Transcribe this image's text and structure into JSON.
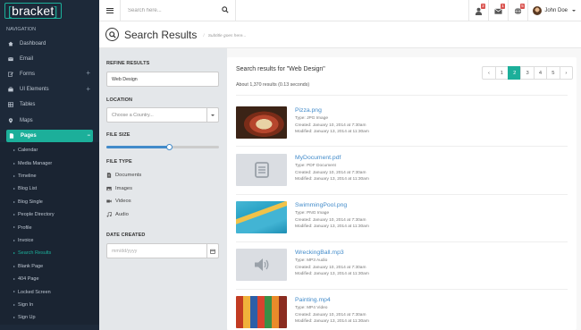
{
  "app": {
    "logo": "bracket",
    "logo_bracket_open": "[",
    "logo_bracket_close": "]"
  },
  "header": {
    "search_placeholder": "Search here...",
    "notifications": [
      {
        "icon": "user-icon",
        "count": "2"
      },
      {
        "icon": "envelope-icon",
        "count": "1"
      },
      {
        "icon": "globe-icon",
        "count": "5"
      }
    ],
    "user_name": "John Doe"
  },
  "sidebar": {
    "title": "NAVIGATION",
    "items": [
      {
        "label": "Dashboard",
        "icon": "home-icon"
      },
      {
        "label": "Email",
        "icon": "envelope-icon"
      },
      {
        "label": "Forms",
        "icon": "edit-icon",
        "expandable": "+"
      },
      {
        "label": "UI Elements",
        "icon": "suitcase-icon",
        "expandable": "+"
      },
      {
        "label": "Tables",
        "icon": "table-icon"
      },
      {
        "label": "Maps",
        "icon": "map-marker-icon"
      },
      {
        "label": "Pages",
        "icon": "file-icon",
        "expandable": "−"
      }
    ],
    "sub_items": [
      "Calendar",
      "Media Manager",
      "Timeline",
      "Blog List",
      "Blog Single",
      "People Directory",
      "Profile",
      "Invoice",
      "Search Results",
      "Blank Page",
      "404 Page",
      "Locked Screen",
      "Sign In",
      "Sign Up"
    ],
    "current_sub": "Search Results"
  },
  "page": {
    "title": "Search Results",
    "subtitle": "Subtitle goes here..."
  },
  "refine": {
    "title": "REFINE RESULTS",
    "query": "Web Design",
    "location_label": "LOCATION",
    "location_placeholder": "Choose a Country...",
    "filesize_label": "FILE SIZE",
    "filesize_fraction": 0.56,
    "filetype_label": "FILE TYPE",
    "filetypes": [
      {
        "label": "Documents",
        "icon": "file-text-icon"
      },
      {
        "label": "Images",
        "icon": "image-icon"
      },
      {
        "label": "Videos",
        "icon": "video-icon"
      },
      {
        "label": "Audio",
        "icon": "music-icon"
      }
    ],
    "date_label": "DATE CREATED",
    "date_placeholder": "mm/dd/yyyy"
  },
  "results": {
    "heading": "Search results for \"Web Design\"",
    "summary": "About 1,370 results (0.13 seconds)",
    "pagination": {
      "prev": "‹",
      "pages": [
        "1",
        "2",
        "3",
        "4",
        "5"
      ],
      "active": "2",
      "next": "›"
    },
    "items": [
      {
        "name": "Pizza.png",
        "type": "Type: JPG Image",
        "created": "Created: January 10, 2014 at 7:30am",
        "modified": "Modified: January 13, 2014 at 11:30am",
        "thumb": "pizza"
      },
      {
        "name": "MyDocument.pdf",
        "type": "Type: PDF Document",
        "created": "Created: January 10, 2014 at 7:30am",
        "modified": "Modified: January 13, 2014 at 11:30am",
        "thumb": "document"
      },
      {
        "name": "SwimmingPool.png",
        "type": "Type: PNG Image",
        "created": "Created: January 10, 2014 at 7:30am",
        "modified": "Modified: January 13, 2014 at 11:30am",
        "thumb": "pool"
      },
      {
        "name": "WreckingBall.mp3",
        "type": "Type: MP3 Audio",
        "created": "Created: January 10, 2014 at 7:30am",
        "modified": "Modified: January 13, 2014 at 11:30am",
        "thumb": "audio"
      },
      {
        "name": "Painting.mp4",
        "type": "Type: MP4 Video",
        "created": "Created: January 10, 2014 at 7:30am",
        "modified": "Modified: January 13, 2014 at 11:30am",
        "thumb": "painting"
      }
    ]
  },
  "colors": {
    "sidebar_bg": "#1d2939",
    "accent": "#1caf9a",
    "link": "#428bca",
    "badge": "#d9534f"
  }
}
